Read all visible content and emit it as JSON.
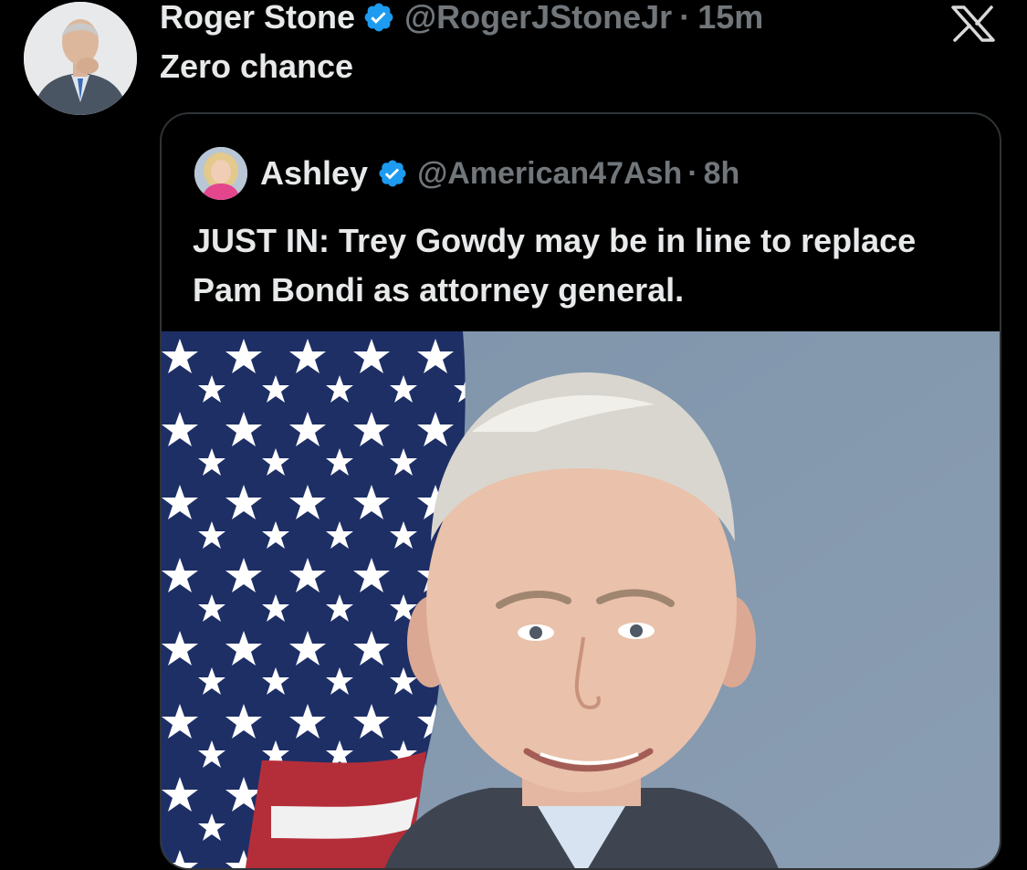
{
  "tweet": {
    "display_name": "Roger Stone",
    "handle": "@RogerJStoneJr",
    "separator": "·",
    "time": "15m",
    "text": "Zero chance",
    "verified_icon": "verified-badge-icon"
  },
  "quoted_tweet": {
    "display_name": "Ashley",
    "handle": "@American47Ash",
    "separator": "·",
    "time": "8h",
    "text": "JUST IN: Trey Gowdy may be in line to replace Pam Bondi as attorney general.",
    "media": "photo-portrait-with-american-flag"
  },
  "brand": {
    "logo_icon": "x-logo-icon"
  },
  "colors": {
    "background": "#000000",
    "primary_text": "#e7e9ea",
    "secondary_text": "#71767b",
    "verified_blue": "#1d9bf0",
    "card_border": "#2f3336"
  }
}
